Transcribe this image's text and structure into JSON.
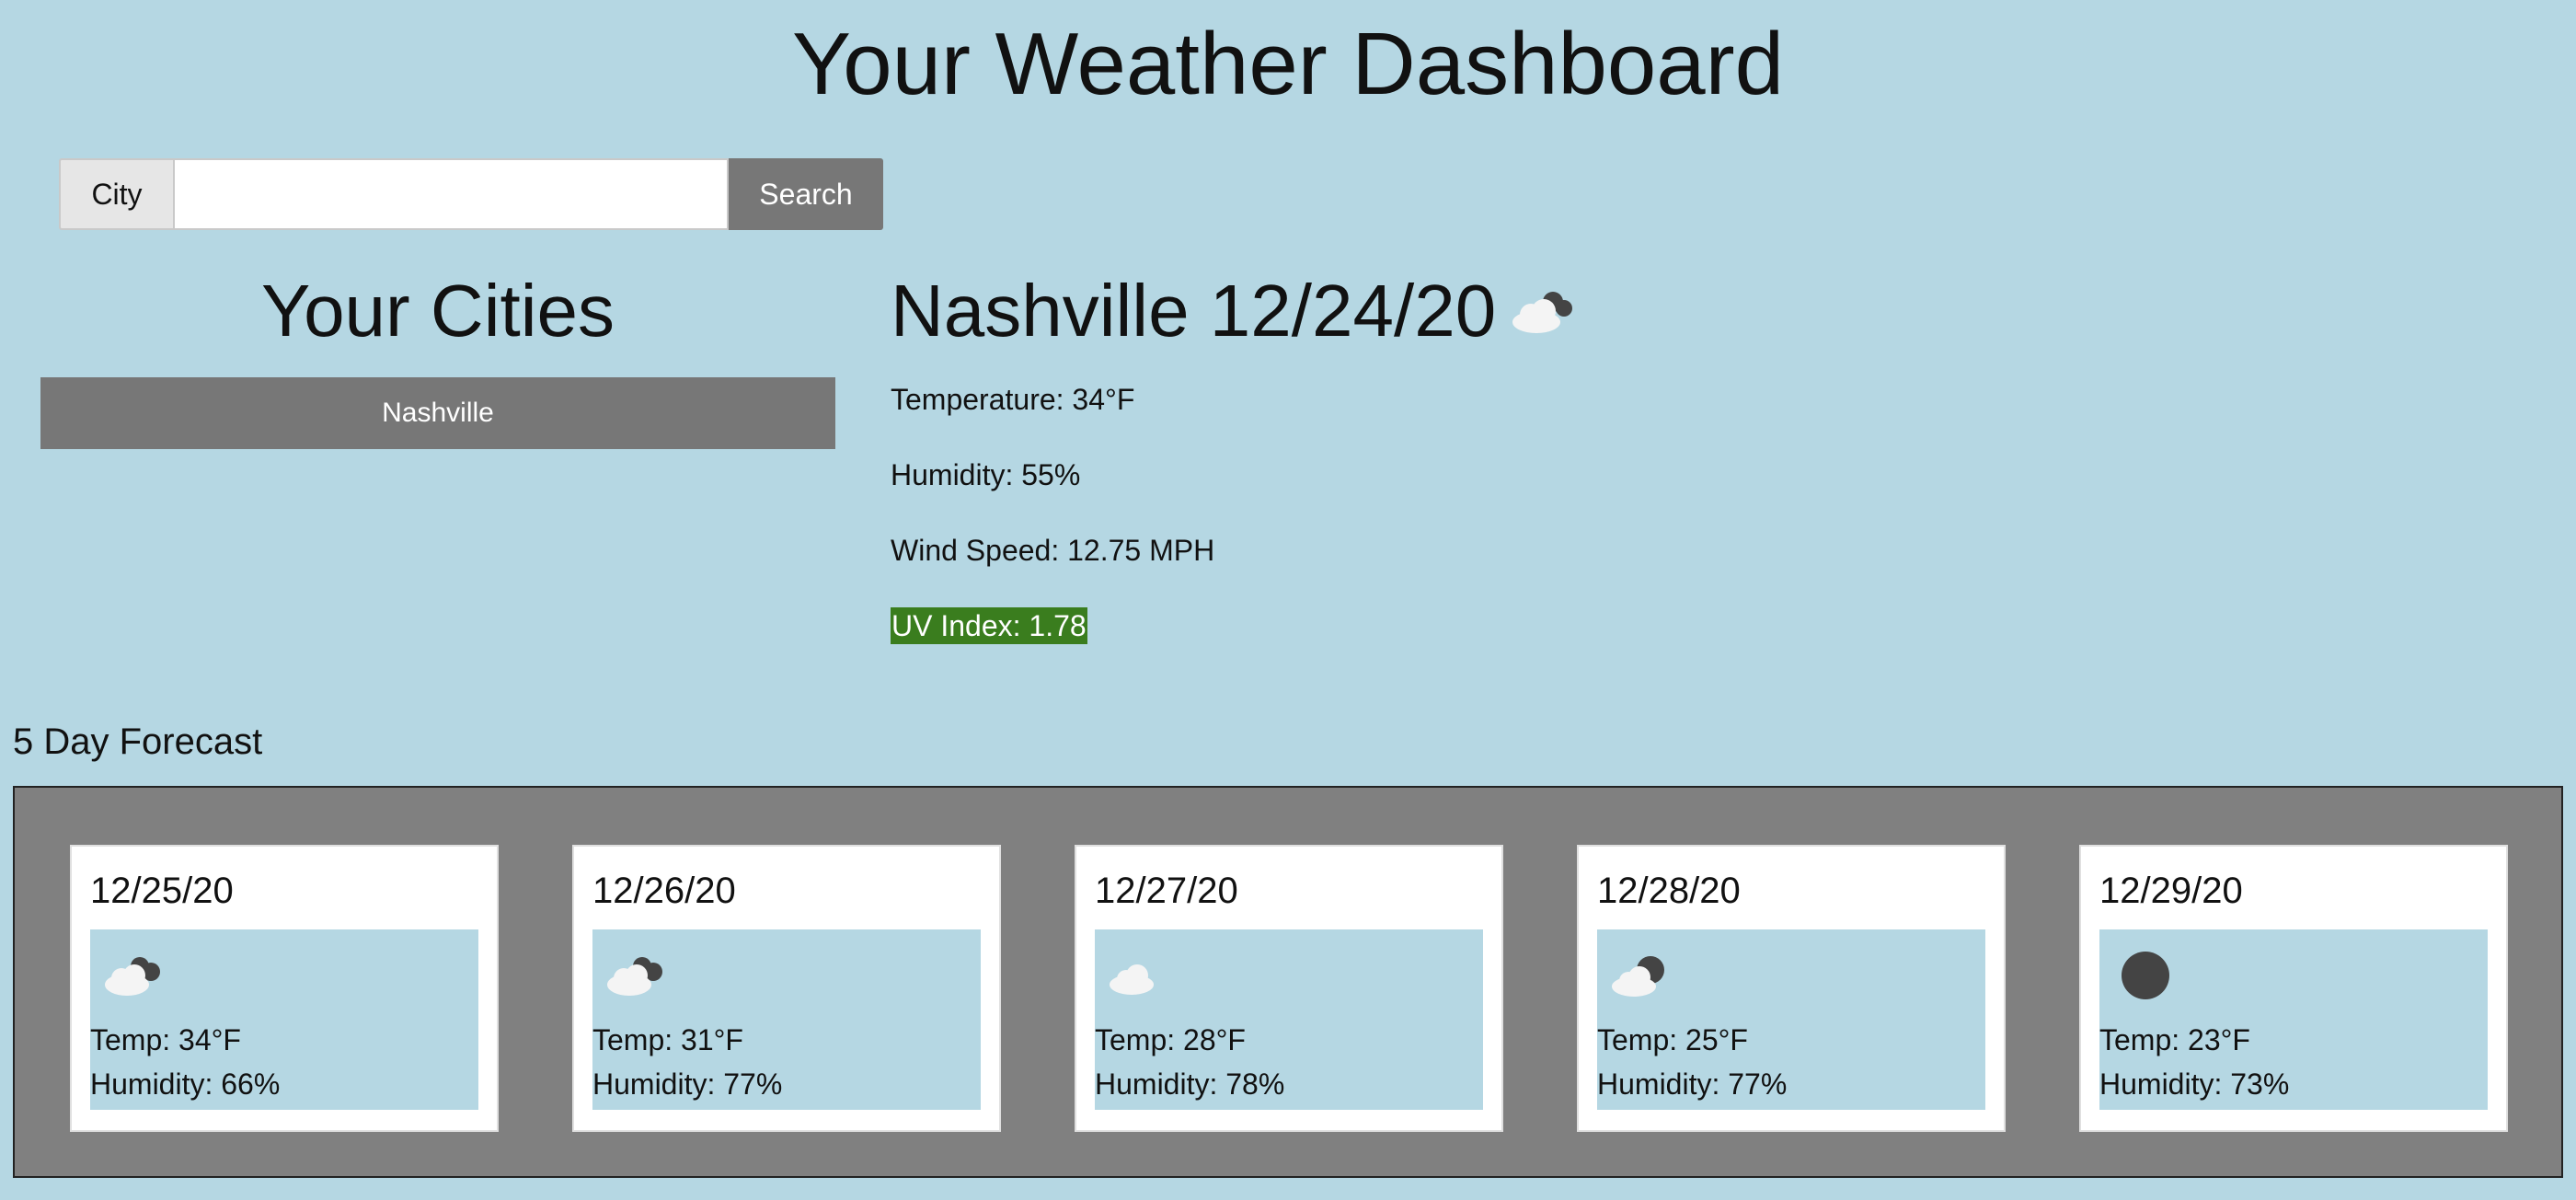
{
  "page": {
    "title": "Your Weather Dashboard"
  },
  "search": {
    "label": "City",
    "value": "",
    "placeholder": "",
    "button_label": "Search"
  },
  "cities": {
    "heading": "Your Cities",
    "items": [
      {
        "label": "Nashville"
      }
    ]
  },
  "current": {
    "title": "Nashville 12/24/20",
    "icon": "partly-cloudy-night-icon",
    "temperature": "Temperature: 34°F",
    "humidity": "Humidity: 55%",
    "wind": "Wind Speed: 12.75 MPH",
    "uv": "UV Index: 1.78",
    "uv_color": "#3a7d1e"
  },
  "forecast": {
    "heading": "5 Day Forecast",
    "days": [
      {
        "date": "12/25/20",
        "icon": "broken-clouds-icon",
        "temp": "Temp: 34°F",
        "humidity": "Humidity: 66%"
      },
      {
        "date": "12/26/20",
        "icon": "broken-clouds-icon",
        "temp": "Temp: 31°F",
        "humidity": "Humidity: 77%"
      },
      {
        "date": "12/27/20",
        "icon": "cloud-icon",
        "temp": "Temp: 28°F",
        "humidity": "Humidity: 78%"
      },
      {
        "date": "12/28/20",
        "icon": "partly-cloudy-night-icon",
        "temp": "Temp: 25°F",
        "humidity": "Humidity: 77%"
      },
      {
        "date": "12/29/20",
        "icon": "clear-night-icon",
        "temp": "Temp: 23°F",
        "humidity": "Humidity: 73%"
      }
    ]
  },
  "colors": {
    "background": "#b5d7e3",
    "button": "#777777",
    "forecast_panel": "#808080",
    "uv_badge": "#3a7d1e"
  }
}
